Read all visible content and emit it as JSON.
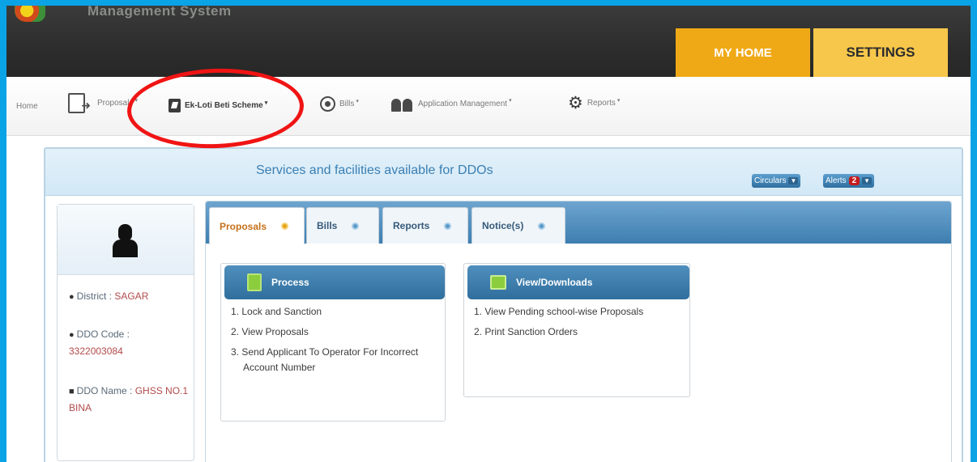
{
  "header": {
    "system_name": "Management System",
    "tabs": {
      "home": "MY HOME",
      "settings": "SETTINGS"
    }
  },
  "nav": {
    "home": "Home",
    "proposals": "Proposals",
    "ekloti": "Ek-Loti Beti Scheme",
    "bills": "Bills",
    "application_management": "Application Management",
    "reports": "Reports",
    "caret": "▾"
  },
  "panel": {
    "title": "Services and facilities available for DDOs",
    "circulars": "Circulars",
    "alerts": "Alerts",
    "alerts_count": "2"
  },
  "profile": {
    "district_label": "District :",
    "district_value": "SAGAR",
    "ddo_code_label": "DDO Code :",
    "ddo_code_value": "3322003084",
    "ddo_name_label": "DDO Name :",
    "ddo_name_value_1": "GHSS NO.1",
    "ddo_name_value_2": "BINA"
  },
  "tabs": [
    "Proposals",
    "Bills",
    "Reports",
    "Notice(s)"
  ],
  "process": {
    "title": "Process",
    "items": [
      "1. Lock and Sanction",
      "2. View Proposals",
      "3. Send Applicant To Operator For Incorrect"
    ],
    "item3_cont": "Account Number"
  },
  "view": {
    "title": "View/Downloads",
    "items": [
      "1. View Pending school-wise Proposals",
      "2. Print Sanction Orders"
    ]
  },
  "colors": {
    "frame": "#0aa3e6",
    "tab_home": "#f0a916",
    "tab_settings": "#f7c74b",
    "annotation": "#f01414",
    "accent_blue": "#3d7eb0"
  }
}
